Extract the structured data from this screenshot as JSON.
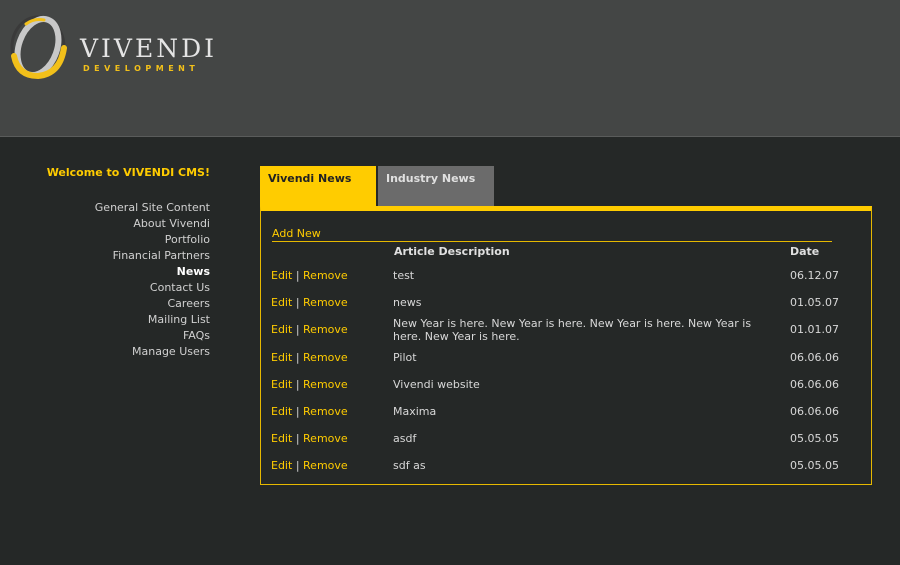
{
  "logo": {
    "word": "VIVENDI",
    "sub": "DEVELOPMENT",
    "colors": {
      "ring_gold": "#f2c01a",
      "ring_silver": "#c8c8c8",
      "text": "#e4e4e4"
    }
  },
  "sidebar": {
    "welcome": "Welcome to VIVENDI CMS!",
    "items": [
      {
        "label": "General Site Content"
      },
      {
        "label": "About Vivendi"
      },
      {
        "label": "Portfolio"
      },
      {
        "label": "Financial Partners"
      },
      {
        "label": "News",
        "active": true
      },
      {
        "label": "Contact Us"
      },
      {
        "label": "Careers"
      },
      {
        "label": "Mailing List"
      },
      {
        "label": "FAQs"
      },
      {
        "label": "Manage Users"
      }
    ]
  },
  "tabs": [
    {
      "label": "Vivendi News",
      "active": true
    },
    {
      "label": "Industry News",
      "active": false
    }
  ],
  "panel": {
    "add_new": "Add New",
    "columns": {
      "description": "Article Description",
      "date": "Date"
    },
    "edit_label": "Edit",
    "separator": "|",
    "remove_label": "Remove",
    "rows": [
      {
        "description": "test",
        "date": "06.12.07"
      },
      {
        "description": "news",
        "date": "01.05.07"
      },
      {
        "description": "New Year is here. New Year is here. New Year is here. New Year is here. New Year is here.",
        "date": "01.01.07"
      },
      {
        "description": "Pilot",
        "date": "06.06.06"
      },
      {
        "description": "Vivendi website",
        "date": "06.06.06"
      },
      {
        "description": "Maxima",
        "date": "06.06.06"
      },
      {
        "description": "asdf",
        "date": "05.05.05"
      },
      {
        "description": "sdf as",
        "date": "05.05.05"
      }
    ]
  },
  "colors": {
    "accent": "#ffcc00",
    "header_bg": "#444645",
    "page_bg": "#252827",
    "inactive_tab": "#6b6b6b"
  }
}
